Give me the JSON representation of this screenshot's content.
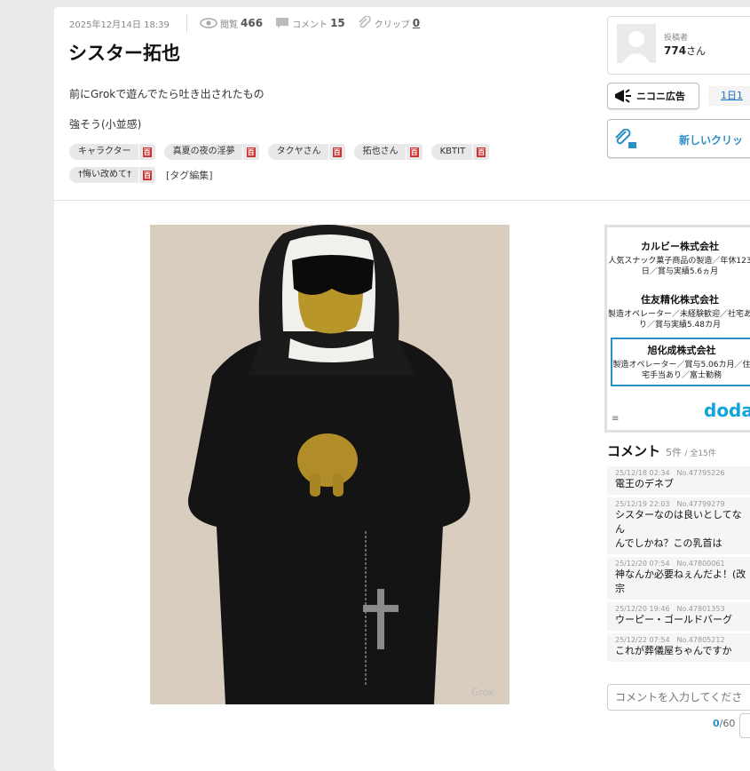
{
  "meta": {
    "date": "2025年12月14日 18:39",
    "views_label": "閲覧",
    "views": "466",
    "comments_label": "コメント",
    "comments": "15",
    "clips_label": "クリップ",
    "clips": "0"
  },
  "title": "シスター拓也",
  "description": [
    "前にGrokで遊んでたら吐き出されたもの",
    "強そう(小並感)"
  ],
  "tags": [
    "キャラクター",
    "真夏の夜の淫夢",
    "タクヤさん",
    "拓也さん",
    "KBTIT",
    "†悔い改めて†"
  ],
  "tag_dic_label": "百",
  "tag_edit": "[タグ編集]",
  "image": {
    "watermark": "Grok"
  },
  "poster": {
    "label": "投稿者",
    "name": "774",
    "suffix": "さん"
  },
  "ad_button": "ニコニ広告",
  "day_button": "1日1",
  "clip_button": "新しいクリッ",
  "ads": [
    {
      "company": "カルビー株式会社",
      "detail": "人気スナック菓子商品の製造／年休123日／賞与実績5.6ヵ月"
    },
    {
      "company": "住友精化株式会社",
      "detail": "製造オペレーター／未経験歓迎／社宅あり／賞与実績5.48カ月"
    },
    {
      "company": "旭化成株式会社",
      "detail": "製造オペレーター／賞与5.06カ月／住宅手当あり／富士勤務"
    }
  ],
  "ad_brand": "doda",
  "ad_mark": "≡",
  "comments_header": {
    "title": "コメント",
    "count": "5件",
    "total": "/ 全15件"
  },
  "comments": [
    {
      "date": "25/12/18 02:34",
      "no": "No.47795226",
      "text": "電王のデネブ"
    },
    {
      "date": "25/12/19 22:03",
      "no": "No.47799279",
      "text": "シスターなのは良いとしてなん\nんでしかね？この乳首は"
    },
    {
      "date": "25/12/20 07:54",
      "no": "No.47800061",
      "text": "神なんか必要ねぇんだよ！(改宗"
    },
    {
      "date": "25/12/20 19:46",
      "no": "No.47801353",
      "text": "ウーピー・ゴールドバーグ"
    },
    {
      "date": "25/12/22 07:54",
      "no": "No.47805212",
      "text": "これが葬儀屋ちゃんですか"
    }
  ],
  "comment_input": {
    "placeholder": "コメントを入力してくださ"
  },
  "comment_count": {
    "current": "0",
    "max": "/60"
  }
}
